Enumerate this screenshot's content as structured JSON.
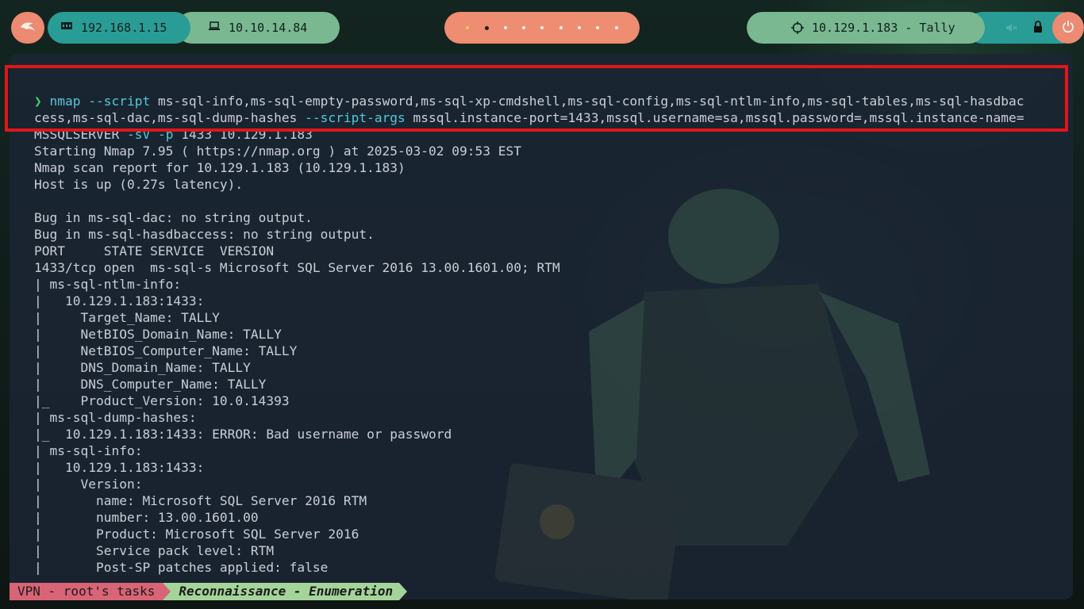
{
  "topbar": {
    "launcher_icon": "kali-dragon-icon",
    "local_ip": "192.168.1.15",
    "local_ip_icon": "network-card-icon",
    "vpn_ip": "10.10.14.84",
    "vpn_ip_icon": "laptop-icon",
    "workspaces_count": 9,
    "active_workspace": 2,
    "target": "10.129.1.183 - Tally",
    "target_icon": "crosshair-icon",
    "volume_icon": "speaker-muted-icon",
    "lock_icon": "lock-icon",
    "power_icon": "power-icon"
  },
  "terminal": {
    "prompt_symbol": "❯",
    "command_name": "nmap",
    "command_line1_rest": " --script ms-sql-info,ms-sql-empty-password,ms-sql-xp-cmdshell,ms-sql-config,ms-sql-ntlm-info,ms-sql-tables,ms-sql-hasdbac",
    "command_line2": "cess,ms-sql-dac,ms-sql-dump-hashes --script-args mssql.instance-port=1433,mssql.username=sa,mssql.password=,mssql.instance-name=",
    "command_line3": "MSSQLSERVER -sV -p 1433 10.129.1.183",
    "output": [
      "Starting Nmap 7.95 ( https://nmap.org ) at 2025-03-02 09:53 EST",
      "Nmap scan report for 10.129.1.183 (10.129.1.183)",
      "Host is up (0.27s latency).",
      "",
      "Bug in ms-sql-dac: no string output.",
      "Bug in ms-sql-hasdbaccess: no string output.",
      "PORT     STATE SERVICE  VERSION",
      "1433/tcp open  ms-sql-s Microsoft SQL Server 2016 13.00.1601.00; RTM",
      "| ms-sql-ntlm-info:",
      "|   10.129.1.183:1433:",
      "|     Target_Name: TALLY",
      "|     NetBIOS_Domain_Name: TALLY",
      "|     NetBIOS_Computer_Name: TALLY",
      "|     DNS_Domain_Name: TALLY",
      "|     DNS_Computer_Name: TALLY",
      "|_    Product_Version: 10.0.14393",
      "| ms-sql-dump-hashes:",
      "|_  10.129.1.183:1433: ERROR: Bad username or password",
      "| ms-sql-info:",
      "|   10.129.1.183:1433:",
      "|     Version:",
      "|       name: Microsoft SQL Server 2016 RTM",
      "|       number: 13.00.1601.00",
      "|       Product: Microsoft SQL Server 2016",
      "|       Service pack level: RTM",
      "|       Post-SP patches applied: false"
    ]
  },
  "statusbar": {
    "left_label": "VPN - root's tasks",
    "right_label": "Reconnaissance - Enumeration"
  },
  "colors": {
    "accent_salmon": "#ee8d71",
    "accent_teal": "#2a9c96",
    "accent_green": "#79b891",
    "highlight_red": "#e0161a",
    "prompt_green": "#3fd06a",
    "command_cyan": "#55c7d6"
  }
}
